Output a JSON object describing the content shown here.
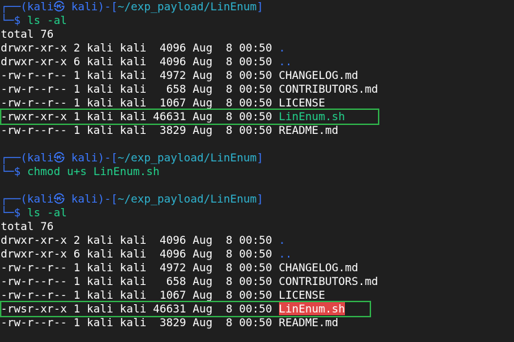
{
  "theme": {
    "background": "#1f1f1f",
    "prompt_color": "#3b78ff",
    "command_color": "#23d18b",
    "highlight_box_color": "#2fb04a",
    "suid_bg": "#e04646"
  },
  "blocks": [
    {
      "prompt": {
        "top_prefix": "┌──(",
        "user_host": "kali㉿ kali",
        "sep": ")-[",
        "path": "~/exp_payload/LinEnum",
        "close": "]",
        "bottom_prefix": "└─$ ",
        "command": "ls -al"
      },
      "total": "total 76",
      "entries": [
        {
          "perm": "drwxr-xr-x",
          "links": "2",
          "owner": "kali",
          "group": "kali",
          "size": " 4096",
          "date": "Aug  8 00:50",
          "name": ".",
          "kind": "dir"
        },
        {
          "perm": "drwxr-xr-x",
          "links": "6",
          "owner": "kali",
          "group": "kali",
          "size": " 4096",
          "date": "Aug  8 00:50",
          "name": "..",
          "kind": "dir"
        },
        {
          "perm": "-rw-r--r--",
          "links": "1",
          "owner": "kali",
          "group": "kali",
          "size": " 4972",
          "date": "Aug  8 00:50",
          "name": "CHANGELOG.md",
          "kind": "file"
        },
        {
          "perm": "-rw-r--r--",
          "links": "1",
          "owner": "kali",
          "group": "kali",
          "size": "  658",
          "date": "Aug  8 00:50",
          "name": "CONTRIBUTORS.md",
          "kind": "file"
        },
        {
          "perm": "-rw-r--r--",
          "links": "1",
          "owner": "kali",
          "group": "kali",
          "size": " 1067",
          "date": "Aug  8 00:50",
          "name": "LICENSE",
          "kind": "file"
        },
        {
          "perm": "-rwxr-xr-x",
          "links": "1",
          "owner": "kali",
          "group": "kali",
          "size": "46631",
          "date": "Aug  8 00:50",
          "name": "LinEnum.sh",
          "kind": "exe",
          "highlight": true
        },
        {
          "perm": "-rw-r--r--",
          "links": "1",
          "owner": "kali",
          "group": "kali",
          "size": " 3829",
          "date": "Aug  8 00:50",
          "name": "README.md",
          "kind": "file"
        }
      ]
    },
    {
      "prompt": {
        "top_prefix": "┌──(",
        "user_host": "kali㉿ kali",
        "sep": ")-[",
        "path": "~/exp_payload/LinEnum",
        "close": "]",
        "bottom_prefix": "└─$ ",
        "command": "chmod u+s LinEnum.sh"
      }
    },
    {
      "prompt": {
        "top_prefix": "┌──(",
        "user_host": "kali㉿ kali",
        "sep": ")-[",
        "path": "~/exp_payload/LinEnum",
        "close": "]",
        "bottom_prefix": "└─$ ",
        "command": "ls -al"
      },
      "total": "total 76",
      "entries": [
        {
          "perm": "drwxr-xr-x",
          "links": "2",
          "owner": "kali",
          "group": "kali",
          "size": " 4096",
          "date": "Aug  8 00:50",
          "name": ".",
          "kind": "dir"
        },
        {
          "perm": "drwxr-xr-x",
          "links": "6",
          "owner": "kali",
          "group": "kali",
          "size": " 4096",
          "date": "Aug  8 00:50",
          "name": "..",
          "kind": "dir"
        },
        {
          "perm": "-rw-r--r--",
          "links": "1",
          "owner": "kali",
          "group": "kali",
          "size": " 4972",
          "date": "Aug  8 00:50",
          "name": "CHANGELOG.md",
          "kind": "file"
        },
        {
          "perm": "-rw-r--r--",
          "links": "1",
          "owner": "kali",
          "group": "kali",
          "size": "  658",
          "date": "Aug  8 00:50",
          "name": "CONTRIBUTORS.md",
          "kind": "file"
        },
        {
          "perm": "-rw-r--r--",
          "links": "1",
          "owner": "kali",
          "group": "kali",
          "size": " 1067",
          "date": "Aug  8 00:50",
          "name": "LICENSE",
          "kind": "file"
        },
        {
          "perm": "-rwsr-xr-x",
          "links": "1",
          "owner": "kali",
          "group": "kali",
          "size": "46631",
          "date": "Aug  8 00:50",
          "name": "LinEnum.sh",
          "kind": "suid",
          "highlight": true
        },
        {
          "perm": "-rw-r--r--",
          "links": "1",
          "owner": "kali",
          "group": "kali",
          "size": " 3829",
          "date": "Aug  8 00:50",
          "name": "README.md",
          "kind": "file"
        }
      ]
    }
  ]
}
